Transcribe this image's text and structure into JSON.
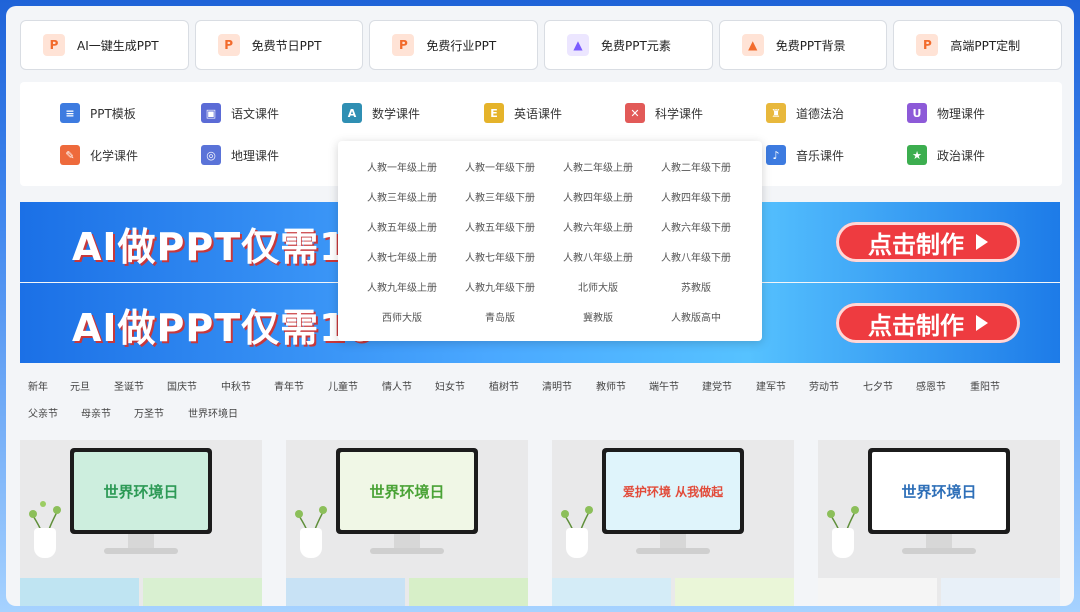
{
  "tools": [
    {
      "label": "AI一键生成PPT",
      "icon": "ppt-icon",
      "glyph": "P"
    },
    {
      "label": "免费节日PPT",
      "icon": "ppt-icon",
      "glyph": "P"
    },
    {
      "label": "免费行业PPT",
      "icon": "ppt-icon",
      "glyph": "P"
    },
    {
      "label": "免费PPT元素",
      "icon": "shapes-icon",
      "glyph": "▲"
    },
    {
      "label": "免费PPT背景",
      "icon": "image-icon",
      "glyph": "▲"
    },
    {
      "label": "高端PPT定制",
      "icon": "ppt-icon",
      "glyph": "P"
    }
  ],
  "categories": [
    {
      "label": "PPT模板",
      "color": "#3d7be0",
      "glyph": "≡"
    },
    {
      "label": "语文课件",
      "color": "#5b6bd6",
      "glyph": "▣"
    },
    {
      "label": "数学课件",
      "color": "#2f8fb3",
      "glyph": "A"
    },
    {
      "label": "英语课件",
      "color": "#e5b32a",
      "glyph": "E"
    },
    {
      "label": "科学课件",
      "color": "#e25a58",
      "glyph": "✕"
    },
    {
      "label": "道德法治",
      "color": "#e8b83c",
      "glyph": "♜"
    },
    {
      "label": "物理课件",
      "color": "#8d5ad8",
      "glyph": "U"
    },
    {
      "label": "化学课件",
      "color": "#ee6a3c",
      "glyph": "✎"
    },
    {
      "label": "地理课件",
      "color": "#5a73d8",
      "glyph": "◎"
    },
    {
      "label": "音乐课件",
      "color": "#3d7be0",
      "glyph": "♪"
    },
    {
      "label": "政治课件",
      "color": "#3cae4f",
      "glyph": "★"
    }
  ],
  "banner": {
    "text": "AI做PPT仅需10",
    "cta": "点击制作"
  },
  "dropdown": {
    "grades": [
      "人教一年级上册",
      "人教一年级下册",
      "人教二年级上册",
      "人教二年级下册",
      "人教三年级上册",
      "人教三年级下册",
      "人教四年级上册",
      "人教四年级下册",
      "人教五年级上册",
      "人教五年级下册",
      "人教六年级上册",
      "人教六年级下册",
      "人教七年级上册",
      "人教七年级下册",
      "人教八年级上册",
      "人教八年级下册",
      "人教九年级上册",
      "人教九年级下册",
      "北师大版",
      "苏教版",
      "西师大版",
      "青岛版",
      "冀教版",
      "人教版高中"
    ]
  },
  "holidays": [
    "新年",
    "元旦",
    "圣诞节",
    "国庆节",
    "中秋节",
    "青年节",
    "儿童节",
    "情人节",
    "妇女节",
    "植树节",
    "清明节",
    "教师节",
    "端午节",
    "建党节",
    "建军节",
    "劳动节",
    "七夕节",
    "感恩节",
    "重阳节",
    "父亲节",
    "母亲节",
    "万圣节",
    "世界环境日"
  ],
  "thumbnails": [
    {
      "title": "世界环境日",
      "bg": "#cdeede",
      "fg": "#2d9a56"
    },
    {
      "title": "世界环境日",
      "bg": "#f0f7e6",
      "fg": "#4aa336"
    },
    {
      "title": "爱护环境 从我做起",
      "bg": "#dff4fb",
      "fg": "#e24b3a"
    },
    {
      "title": "世界环境日",
      "bg": "#ffffff",
      "fg": "#2e6fb8"
    }
  ]
}
